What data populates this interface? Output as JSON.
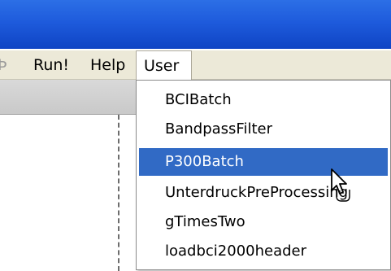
{
  "menu_bar": {
    "partial_item": "Þ",
    "items": [
      "Run!",
      "Help",
      "User"
    ]
  },
  "user_menu": {
    "items": [
      {
        "label": "BCIBatch",
        "selected": false
      },
      {
        "label": "BandpassFilter",
        "selected": false
      },
      {
        "label": "P300Batch",
        "selected": true
      },
      {
        "label": "UnterdruckPreProcessing",
        "selected": false
      },
      {
        "label": "gTimesTwo",
        "selected": false
      },
      {
        "label": "loadbci2000header",
        "selected": false
      }
    ]
  },
  "colors": {
    "title_bar": "#1e5bdc",
    "menu_bar": "#ece9d8",
    "selection": "#316ac5"
  },
  "cursor": {
    "icon": "hand-pointer-icon"
  }
}
